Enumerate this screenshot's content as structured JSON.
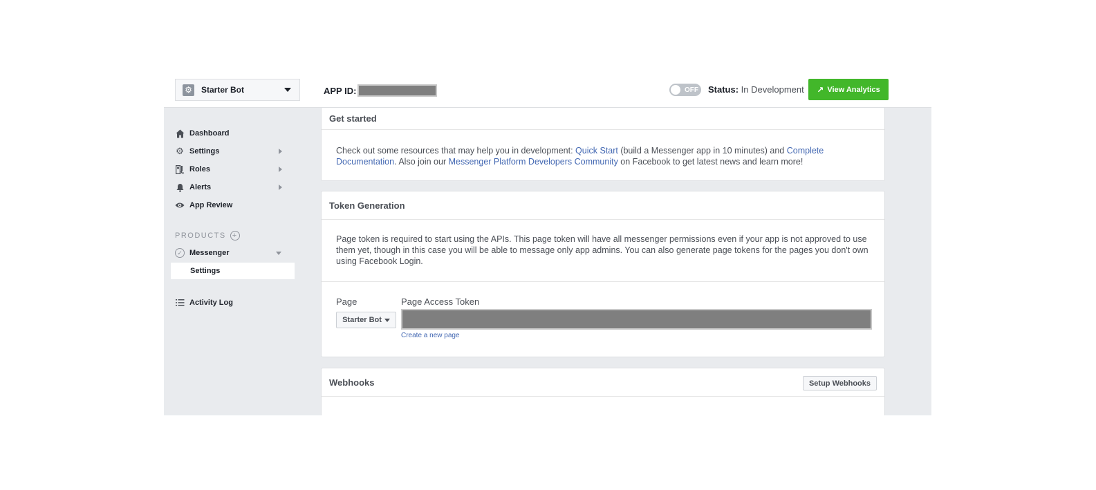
{
  "header": {
    "app_name": "Starter Bot",
    "app_id_label": "APP ID:",
    "toggle_text": "OFF",
    "status_label": "Status:",
    "status_value": " In Development",
    "view_analytics_label": "View Analytics"
  },
  "sidebar": {
    "items": [
      {
        "label": "Dashboard",
        "icon": "home-icon"
      },
      {
        "label": "Settings",
        "icon": "gear-icon"
      },
      {
        "label": "Roles",
        "icon": "roles-icon"
      },
      {
        "label": "Alerts",
        "icon": "bell-icon"
      },
      {
        "label": "App Review",
        "icon": "eye-icon"
      }
    ],
    "products_label": "PRODUCTS",
    "product_name": "Messenger",
    "product_sub_item": "Settings",
    "activity_log": "Activity Log"
  },
  "get_started": {
    "title": "Get started",
    "text_1": "Check out some resources that may help you in development: ",
    "link_quick_start": "Quick Start",
    "text_2": " (build a Messenger app in 10 minutes) and ",
    "link_docs": "Complete Documentation",
    "text_3": ". Also join our ",
    "link_community": "Messenger Platform Developers Community",
    "text_4": " on Facebook to get latest news and learn more!"
  },
  "token_generation": {
    "title": "Token Generation",
    "description": "Page token is required to start using the APIs. This page token will have all messenger permissions even if your app is not approved to use them yet, though in this case you will be able to message only app admins. You can also generate page tokens for the pages you don't own using Facebook Login.",
    "page_label": "Page",
    "page_value": "Starter Bot",
    "token_label": "Page Access Token",
    "create_page_link": "Create a new page"
  },
  "webhooks": {
    "title": "Webhooks",
    "setup_button": "Setup Webhooks"
  },
  "colors": {
    "accent_green": "#42b72a",
    "link_blue": "#4267b2",
    "background_gray": "#e9ebee"
  }
}
